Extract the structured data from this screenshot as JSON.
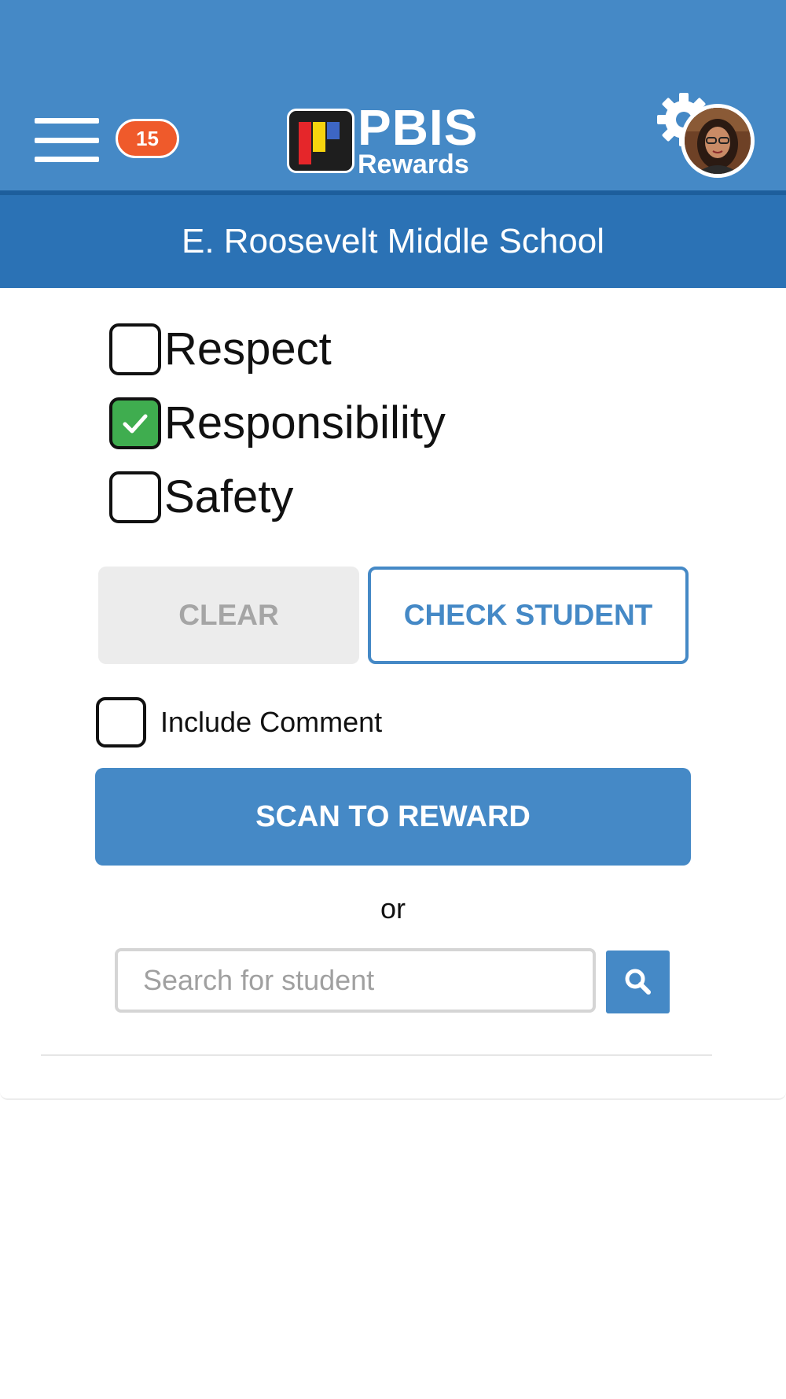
{
  "header": {
    "notification_count": "15",
    "logo": {
      "line1": "PBIS",
      "line2": "Rewards"
    },
    "icons": {
      "menu": "hamburger-menu-icon",
      "settings": "gear-icon",
      "avatar": "user-avatar"
    }
  },
  "school": {
    "name": "E. Roosevelt Middle School"
  },
  "behaviors": [
    {
      "label": "Respect",
      "checked": false
    },
    {
      "label": "Responsibility",
      "checked": true
    },
    {
      "label": "Safety",
      "checked": false
    }
  ],
  "actions": {
    "clear_label": "CLEAR",
    "check_student_label": "CHECK STUDENT",
    "include_comment_label": "Include Comment",
    "include_comment_checked": false,
    "scan_label": "SCAN TO REWARD",
    "or_label": "or"
  },
  "search": {
    "placeholder": "Search for student",
    "value": "",
    "icon": "search-icon"
  },
  "colors": {
    "header": "#4589c6",
    "school_bar": "#2b72b5",
    "badge": "#ef5a2b",
    "checked": "#3fad4f",
    "primary": "#4589c6"
  }
}
